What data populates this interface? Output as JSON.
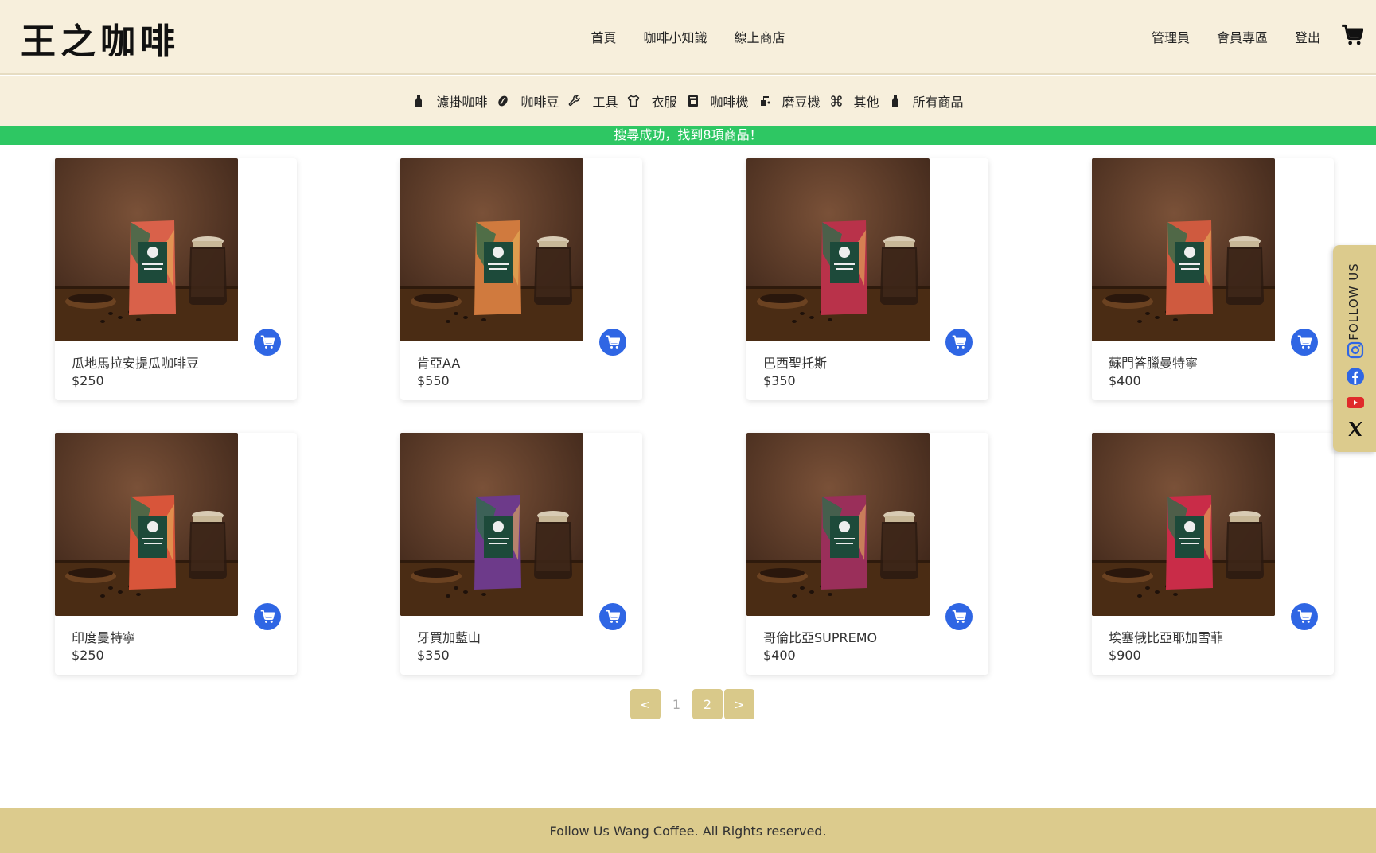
{
  "brand": {
    "logo": "王之咖啡"
  },
  "nav": {
    "main": [
      "首頁",
      "咖啡小知識",
      "線上商店"
    ],
    "right": [
      "管理員",
      "會員專區",
      "登出"
    ]
  },
  "categories": [
    {
      "label": "濾掛咖啡",
      "icon": "bottle-icon"
    },
    {
      "label": "咖啡豆",
      "icon": "bean-icon"
    },
    {
      "label": "工具",
      "icon": "wrench-icon"
    },
    {
      "label": "衣服",
      "icon": "shirt-icon"
    },
    {
      "label": "咖啡機",
      "icon": "machine-icon"
    },
    {
      "label": "磨豆機",
      "icon": "grinder-icon"
    },
    {
      "label": "其他",
      "icon": "command-icon"
    },
    {
      "label": "所有商品",
      "icon": "bottle-icon"
    }
  ],
  "alert": {
    "message": "搜尋成功，找到8項商品！",
    "color": "#2ec763"
  },
  "products": [
    {
      "name": "瓜地馬拉安提瓜咖啡豆",
      "price": "$250",
      "bag_color": "#d9614a"
    },
    {
      "name": "肯亞AA",
      "price": "$550",
      "bag_color": "#d07a3e"
    },
    {
      "name": "巴西聖托斯",
      "price": "$350",
      "bag_color": "#b9324a"
    },
    {
      "name": "蘇門答臘曼特寧",
      "price": "$400",
      "bag_color": "#cf5a3f"
    },
    {
      "name": "印度曼特寧",
      "price": "$250",
      "bag_color": "#d8553a"
    },
    {
      "name": "牙買加藍山",
      "price": "$350",
      "bag_color": "#6d3a8a"
    },
    {
      "name": "哥倫比亞SUPREMO",
      "price": "$400",
      "bag_color": "#9a2f5a"
    },
    {
      "name": "埃塞俄比亞耶加雪菲",
      "price": "$900",
      "bag_color": "#c92c48"
    }
  ],
  "pagination": {
    "prev": "<",
    "pages": [
      "1",
      "2"
    ],
    "current": "1",
    "next": ">"
  },
  "footer": {
    "text": "Follow Us Wang Coffee. All Rights reserved."
  },
  "follow": {
    "label": "FOLLOW US",
    "icons": [
      "instagram-icon",
      "facebook-icon",
      "youtube-icon",
      "x-icon"
    ]
  },
  "colors": {
    "header_bg": "#f7efdc",
    "accent_gold": "#dccb8d",
    "cart_blue": "#2f66e4"
  }
}
